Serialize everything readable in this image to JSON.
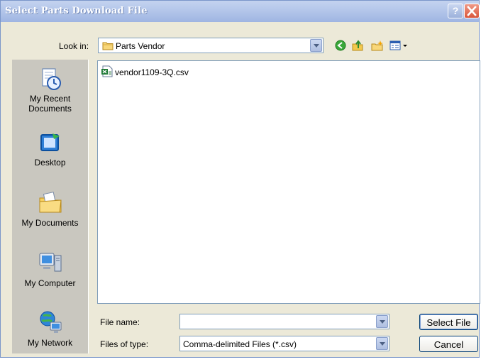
{
  "window": {
    "title": "Select Parts Download File"
  },
  "toolbar": {
    "look_in_label": "Look in:",
    "look_in_value": "Parts Vendor",
    "tools": [
      "back-icon",
      "up-folder-icon",
      "new-folder-icon",
      "views-menu-icon"
    ]
  },
  "places": [
    {
      "label_line1": "My Recent",
      "label_line2": "Documents",
      "icon": "recent-documents-icon"
    },
    {
      "label_line1": "Desktop",
      "label_line2": "",
      "icon": "desktop-icon"
    },
    {
      "label_line1": "My Documents",
      "label_line2": "",
      "icon": "my-documents-icon"
    },
    {
      "label_line1": "My Computer",
      "label_line2": "",
      "icon": "my-computer-icon"
    },
    {
      "label_line1": "My Network",
      "label_line2": "",
      "icon": "my-network-icon"
    }
  ],
  "files": [
    {
      "name": "vendor1109-3Q.csv",
      "icon": "csv-file-icon"
    }
  ],
  "form": {
    "file_name_label": "File name:",
    "file_name_value": "",
    "file_type_label": "Files of type:",
    "file_type_value": "Comma-delimited Files (*.csv)"
  },
  "buttons": {
    "select": "Select File",
    "cancel": "Cancel"
  },
  "colors": {
    "title_bar": "#b4c6ea",
    "places_bar": "#c9c7bf",
    "dialog_bg": "#ece9d8",
    "close_button": "#d9553a"
  }
}
